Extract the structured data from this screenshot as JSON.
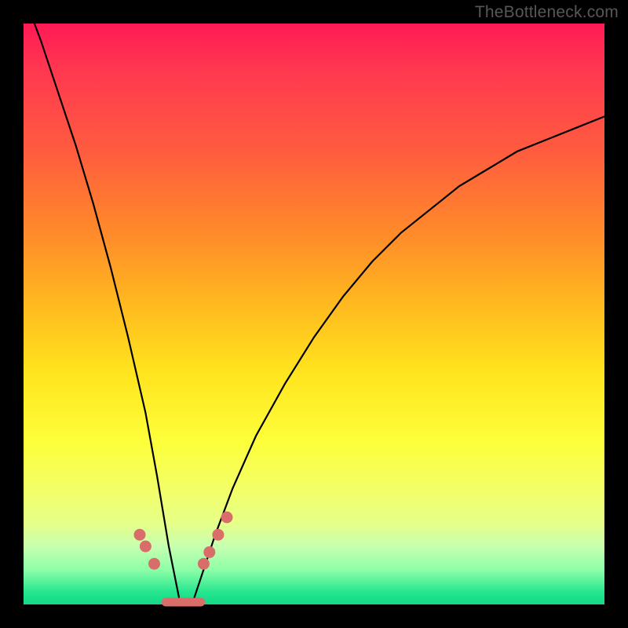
{
  "watermark": "TheBottleneck.com",
  "colors": {
    "marker": "#d96d6a",
    "curve": "#000000",
    "frame": "#000000"
  },
  "chart_data": {
    "type": "line",
    "title": "",
    "xlabel": "",
    "ylabel": "",
    "xlim": [
      0,
      100
    ],
    "ylim": [
      0,
      100
    ],
    "grid": false,
    "legend_position": "none",
    "note": "Bottleneck-percentage style curve. Y is visual height (0 = bottom/green, 100 = top/red). Minimum near x≈27 at y≈0.",
    "series": [
      {
        "name": "bottleneck-curve",
        "x": [
          0,
          3,
          6,
          9,
          12,
          15,
          18,
          21,
          23,
          25,
          27,
          29,
          31,
          33,
          36,
          40,
          45,
          50,
          55,
          60,
          65,
          70,
          75,
          80,
          85,
          90,
          95,
          100
        ],
        "values": [
          105,
          97,
          88,
          79,
          69,
          58,
          46,
          33,
          22,
          10,
          0,
          0,
          6,
          12,
          20,
          29,
          38,
          46,
          53,
          59,
          64,
          68,
          72,
          75,
          78,
          80,
          82,
          84
        ]
      }
    ],
    "markers": [
      {
        "x": 20.0,
        "y": 12
      },
      {
        "x": 21.0,
        "y": 10
      },
      {
        "x": 22.5,
        "y": 7
      },
      {
        "x": 31.0,
        "y": 7
      },
      {
        "x": 32.0,
        "y": 9
      },
      {
        "x": 33.5,
        "y": 12
      },
      {
        "x": 35.0,
        "y": 15
      }
    ],
    "flat_segment": {
      "x_start": 24.5,
      "x_end": 30.5,
      "y": 0
    }
  }
}
